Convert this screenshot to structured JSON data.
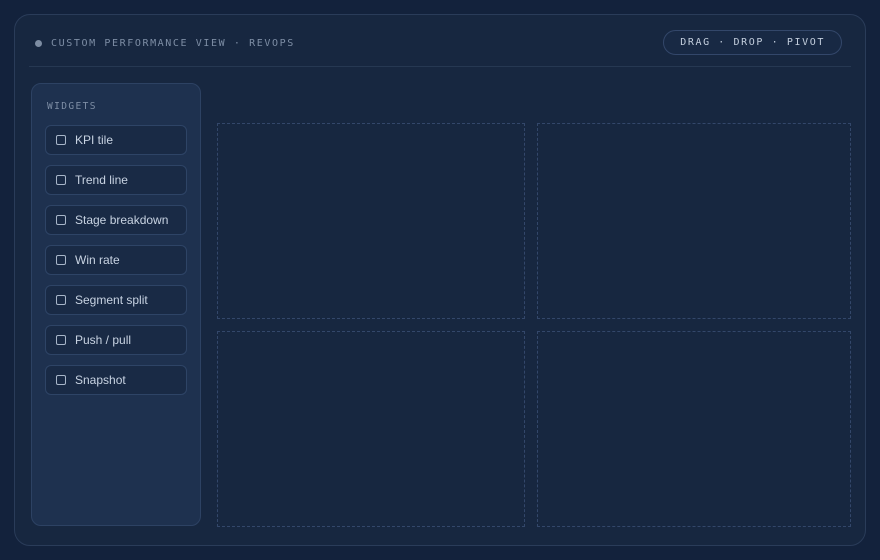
{
  "header": {
    "title": "CUSTOM PERFORMANCE VIEW · REVOPS",
    "badge": "DRAG · DROP · PIVOT"
  },
  "sidebar": {
    "heading": "WIDGETS",
    "items": [
      {
        "label": "KPI tile",
        "icon": "square-icon"
      },
      {
        "label": "Trend line",
        "icon": "square-icon"
      },
      {
        "label": "Stage breakdown",
        "icon": "square-icon"
      },
      {
        "label": "Win rate",
        "icon": "square-icon"
      },
      {
        "label": "Segment split",
        "icon": "square-icon"
      },
      {
        "label": "Push / pull",
        "icon": "square-icon"
      },
      {
        "label": "Snapshot",
        "icon": "square-icon"
      }
    ]
  },
  "canvas": {
    "slots": [
      "",
      "",
      "",
      ""
    ]
  },
  "colors": {
    "background": "#13223c",
    "panel": "#172740",
    "sidebar": "#1e314f",
    "border": "#2a3c59",
    "text_muted": "#7e8ea5",
    "text": "#c8d3e2"
  }
}
